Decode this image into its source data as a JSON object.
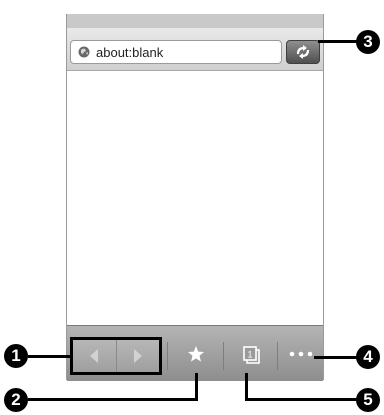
{
  "browser": {
    "url": "about:blank",
    "tab_count": "1"
  },
  "icons": {
    "site": "globe-icon",
    "refresh": "refresh-icon",
    "back": "back-arrow-icon",
    "forward": "forward-arrow-icon",
    "bookmark": "star-icon",
    "tabs": "windows-icon",
    "more": "more-dots-icon"
  },
  "callouts": [
    "1",
    "2",
    "3",
    "4",
    "5"
  ],
  "colors": {
    "toolbar": "#9e9e9e",
    "urlbar": "#dcdcdc",
    "callout": "#000000"
  }
}
